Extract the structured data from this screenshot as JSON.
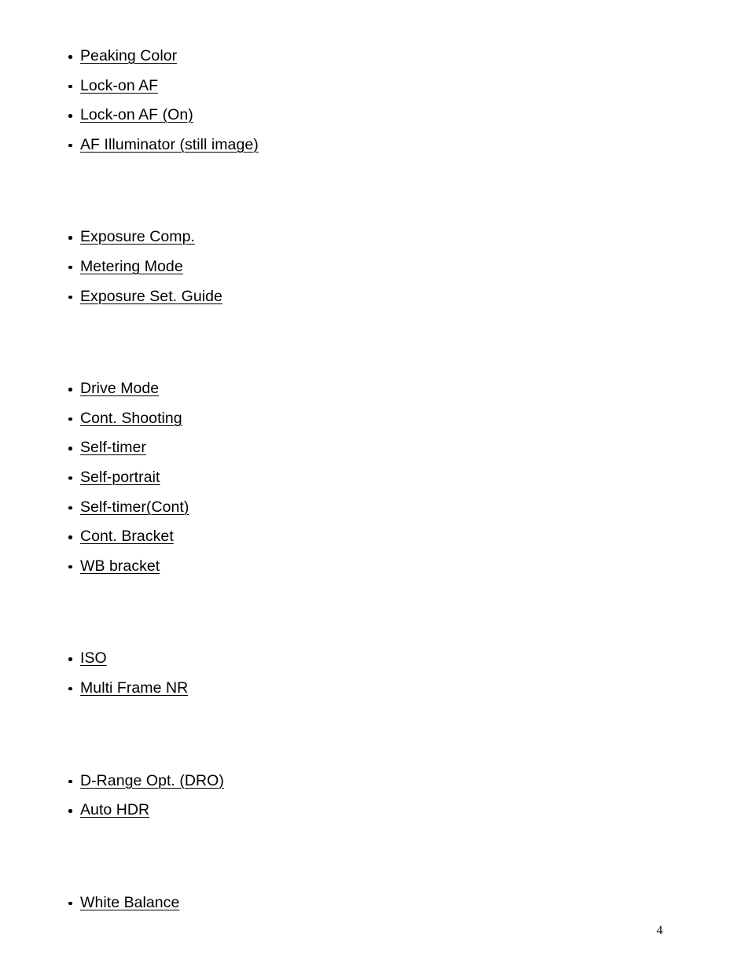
{
  "document": {
    "page_number": "4",
    "background_color": "#ffffff",
    "text_color": "#000000",
    "link_style": "underlined"
  },
  "groups": [
    {
      "id": "focus-group",
      "items": [
        {
          "label": "Peaking Color"
        },
        {
          "label": "Lock-on AF"
        },
        {
          "label": "Lock-on AF (On)"
        },
        {
          "label": "AF Illuminator (still image)"
        }
      ]
    },
    {
      "id": "exposure-group",
      "items": [
        {
          "label": "Exposure Comp."
        },
        {
          "label": "Metering Mode"
        },
        {
          "label": "Exposure Set. Guide"
        }
      ]
    },
    {
      "id": "drive-group",
      "items": [
        {
          "label": "Drive Mode"
        },
        {
          "label": "Cont. Shooting"
        },
        {
          "label": "Self-timer"
        },
        {
          "label": "Self-portrait"
        },
        {
          "label": "Self-timer(Cont)"
        },
        {
          "label": "Cont. Bracket"
        },
        {
          "label": "WB bracket"
        }
      ]
    },
    {
      "id": "iso-group",
      "items": [
        {
          "label": "ISO"
        },
        {
          "label": "Multi Frame NR"
        }
      ]
    },
    {
      "id": "dro-group",
      "items": [
        {
          "label": "D-Range Opt. (DRO)"
        },
        {
          "label": "Auto HDR"
        }
      ]
    },
    {
      "id": "white-balance-group",
      "items": [
        {
          "label": "White Balance"
        }
      ]
    }
  ]
}
